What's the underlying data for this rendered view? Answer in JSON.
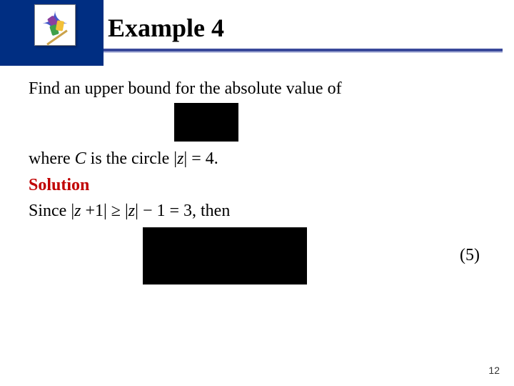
{
  "header": {
    "title": "Example 4"
  },
  "icon": {
    "name": "math-tools-icon"
  },
  "body": {
    "line1": "Find an upper bound for the absolute value of",
    "line2_prefix": "where ",
    "line2_var_C": "C",
    "line2_mid": " is the circle |",
    "line2_var_z": "z",
    "line2_suffix": "| = 4.",
    "solution_label": "Solution",
    "line3_prefix": "Since |",
    "line3_var_z1": "z",
    "line3_mid1": " +1| ≥ |",
    "line3_var_z2": "z",
    "line3_suffix": "| − 1 = 3, then"
  },
  "equation_labels": {
    "eq2": "(5)"
  },
  "page_number": "12"
}
